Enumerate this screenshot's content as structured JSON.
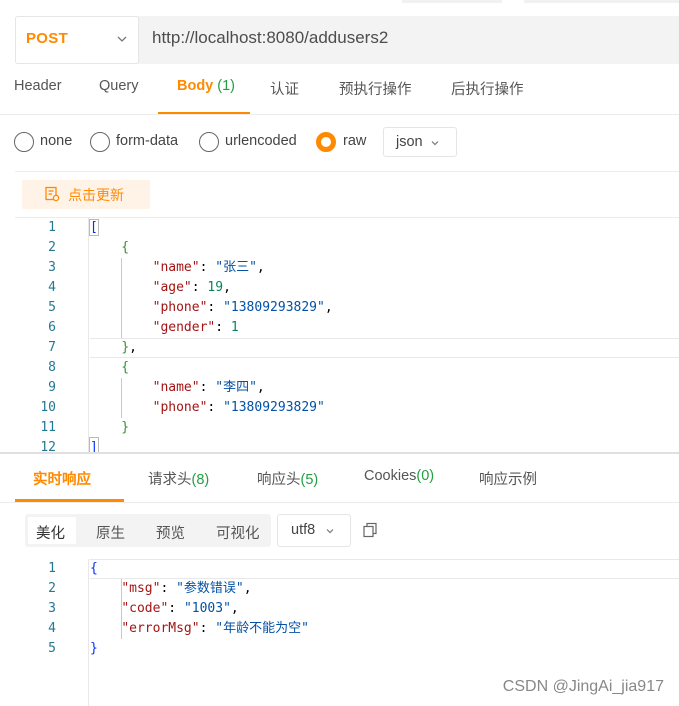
{
  "request": {
    "method": "POST",
    "url": "http://localhost:8080/addusers2"
  },
  "request_tabs": [
    {
      "label": "Header"
    },
    {
      "label": "Query"
    },
    {
      "label": "Body",
      "count": "(1)"
    },
    {
      "label": "认证"
    },
    {
      "label": "预执行操作"
    },
    {
      "label": "后执行操作"
    }
  ],
  "body_types": [
    {
      "label": "none",
      "checked": false
    },
    {
      "label": "form-data",
      "checked": false
    },
    {
      "label": "urlencoded",
      "checked": false
    },
    {
      "label": "raw",
      "checked": true
    }
  ],
  "raw_format": "json",
  "update_button": "点击更新",
  "request_body_line_numbers": [
    "1",
    "2",
    "3",
    "4",
    "5",
    "6",
    "7",
    "8",
    "9",
    "10",
    "11",
    "12"
  ],
  "request_body_lines": [
    "[",
    "    {",
    "        \"name\": \"张三\",",
    "        \"age\": 19,",
    "        \"phone\": \"13809293829\",",
    "        \"gender\": 1",
    "    },",
    "    {",
    "        \"name\": \"李四\",",
    "        \"phone\": \"13809293829\"",
    "    }",
    "]"
  ],
  "response_tabs": [
    {
      "label": "实时响应"
    },
    {
      "label": "请求头",
      "count": "(8)"
    },
    {
      "label": "响应头",
      "count": "(5)"
    },
    {
      "label": "Cookies",
      "count": "(0)"
    },
    {
      "label": "响应示例"
    }
  ],
  "view_modes": [
    "美化",
    "原生",
    "预览",
    "可视化"
  ],
  "encoding": "utf8",
  "response_line_numbers": [
    "1",
    "2",
    "3",
    "4",
    "5"
  ],
  "response_body_lines": [
    "{",
    "    \"msg\": \"参数错误\",",
    "    \"code\": \"1003\",",
    "    \"errorMsg\": \"年龄不能为空\"",
    "}"
  ],
  "watermark": "CSDN @JingAi_jia917",
  "colors": {
    "accent": "#ff8a00",
    "count_green": "#22a043"
  }
}
